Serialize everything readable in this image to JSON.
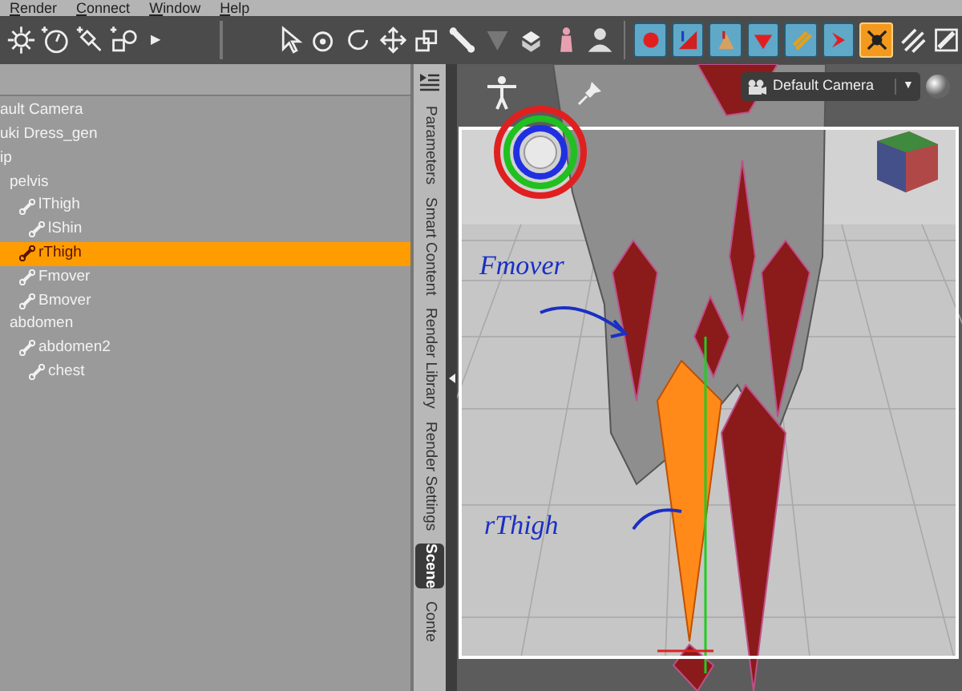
{
  "menu": [
    {
      "label": "Render"
    },
    {
      "label": "Connect"
    },
    {
      "label": "Window"
    },
    {
      "label": "Help"
    }
  ],
  "toolbar": {
    "more_arrow": "▶",
    "mode_buttons": [
      {
        "selected": false
      },
      {
        "selected": false
      },
      {
        "selected": false
      },
      {
        "selected": false
      },
      {
        "selected": false
      },
      {
        "selected": false
      },
      {
        "selected": true
      }
    ]
  },
  "scene_tree": {
    "items": [
      {
        "label": "ault Camera",
        "kind": "node",
        "selected": false
      },
      {
        "label": "uki Dress_gen",
        "kind": "node",
        "selected": false
      },
      {
        "label": "ip",
        "kind": "node",
        "selected": false,
        "children": [
          {
            "label": "pelvis",
            "kind": "node",
            "selected": false,
            "children": [
              {
                "label": "lThigh",
                "kind": "bone",
                "selected": false,
                "children": [
                  {
                    "label": "lShin",
                    "kind": "bone",
                    "selected": false
                  }
                ]
              },
              {
                "label": "rThigh",
                "kind": "bone",
                "selected": true
              },
              {
                "label": "Fmover",
                "kind": "bone",
                "selected": false
              },
              {
                "label": "Bmover",
                "kind": "bone",
                "selected": false
              }
            ]
          },
          {
            "label": "abdomen",
            "kind": "node",
            "selected": false,
            "children": [
              {
                "label": "abdomen2",
                "kind": "bone",
                "selected": false,
                "children": [
                  {
                    "label": "chest",
                    "kind": "bone",
                    "selected": false
                  }
                ]
              }
            ]
          }
        ]
      }
    ]
  },
  "side_tabs": [
    {
      "label": "Parameters",
      "selected": false
    },
    {
      "label": "Smart Content",
      "selected": false
    },
    {
      "label": "Render Library",
      "selected": false
    },
    {
      "label": "Render Settings",
      "selected": false
    },
    {
      "label": "Scene",
      "selected": true
    },
    {
      "label": "Conte",
      "selected": false
    }
  ],
  "viewport": {
    "camera": "Default Camera",
    "caret": "▼",
    "annotations": [
      {
        "text": "Fmover"
      },
      {
        "text": "rThigh"
      }
    ]
  }
}
